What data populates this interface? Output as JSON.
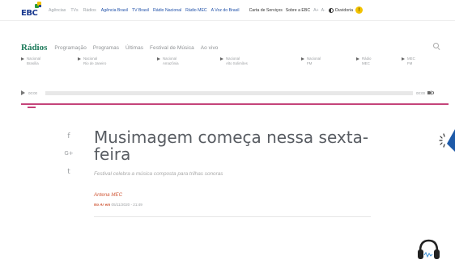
{
  "topbar": {
    "logo": "EBC",
    "nav": [
      {
        "label": "Agências",
        "style": "gray"
      },
      {
        "label": "TVs",
        "style": "gray"
      },
      {
        "label": "Rádios",
        "style": "gray"
      },
      {
        "label": "Agência Brasil",
        "style": "blue"
      },
      {
        "label": "TV Brasil",
        "style": "blue"
      },
      {
        "label": "Rádio Nacional",
        "style": "blue"
      },
      {
        "label": "Rádio MEC",
        "style": "blue"
      },
      {
        "label": "A Voz do Brasil",
        "style": "blue"
      },
      {
        "label": "Carta de Serviços",
        "style": "dark"
      },
      {
        "label": "Sobre a EBC",
        "style": "dark"
      },
      {
        "label": "A+",
        "style": "gray"
      },
      {
        "label": "A-",
        "style": "gray"
      }
    ],
    "ouvidoria": "Ouvidoria",
    "logo_colors": [
      "#2e9b3a",
      "#f2c200",
      "#1a3a8f"
    ]
  },
  "radios_nav": {
    "title": "Rádios",
    "items": [
      "Programação",
      "Programas",
      "Últimas",
      "Festival de Música",
      "Ao vivo"
    ]
  },
  "stations": [
    {
      "line1": "Nacional",
      "line2": "Brasília"
    },
    {
      "line1": "Nacional",
      "line2": "Rio de Janeiro"
    },
    {
      "line1": "Nacional",
      "line2": "Amazônia"
    },
    {
      "line1": "Nacional",
      "line2": "Alto Solimões"
    },
    {
      "line1": "Nacional",
      "line2": "FM"
    },
    {
      "line1": "Rádio",
      "line2": "MEC"
    },
    {
      "line1": "MEC",
      "line2": "FM"
    }
  ],
  "player": {
    "current_time": "00:00",
    "total_time": "00:00",
    "progress": 0
  },
  "social": [
    "f",
    "G+",
    "t"
  ],
  "article": {
    "headline": "Musimagem começa nessa sexta-feira",
    "lead": "Festival celebra a música composta para trilhas sonoras",
    "author": "Antena MEC",
    "date_label": "No Ar em",
    "date_value": "05/11/2020 - 21:49"
  },
  "accent": "#c4447a",
  "brand_green": "#1c7a5a"
}
